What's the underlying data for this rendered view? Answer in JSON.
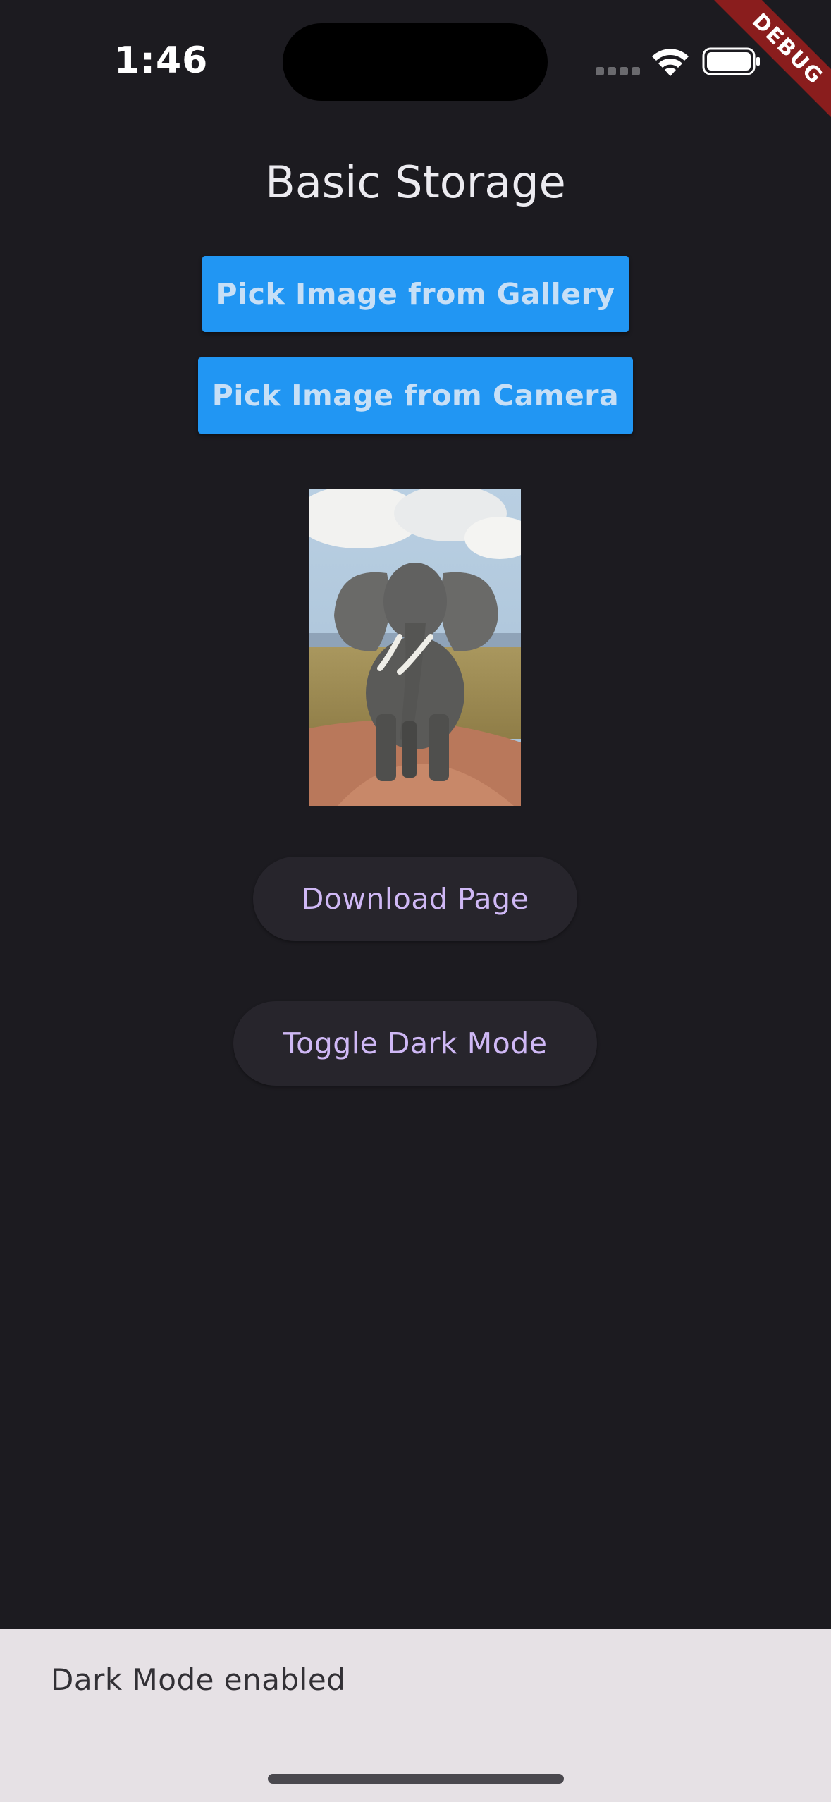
{
  "status_bar": {
    "time": "1:46",
    "icons": [
      "cellular-signal-icon",
      "wifi-icon",
      "battery-icon"
    ]
  },
  "debug_banner": {
    "label": "DEBUG",
    "color": "#8a1d1d"
  },
  "page": {
    "title": "Basic Storage",
    "buttons": {
      "pick_gallery": "Pick Image from Gallery",
      "pick_camera": "Pick Image from Camera",
      "download_page": "Download Page",
      "toggle_dark_mode": "Toggle Dark Mode"
    },
    "image": {
      "description": "elephant-photo"
    }
  },
  "snackbar": {
    "message": "Dark Mode enabled"
  },
  "colors": {
    "background": "#1c1b20",
    "primary_button": "#2196f3",
    "pill_button": "#27252c",
    "pill_text": "#cfb8f5",
    "snackbar": "#e6e1e5"
  }
}
